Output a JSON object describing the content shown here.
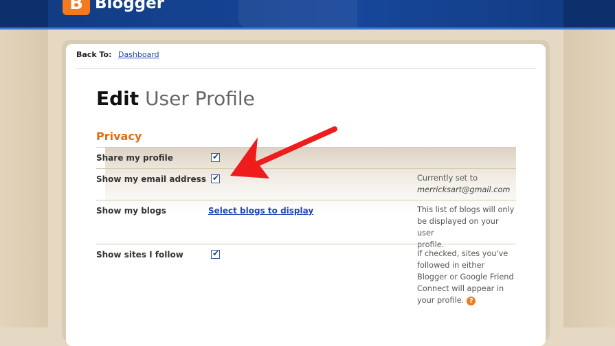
{
  "header": {
    "logo_letter": "B",
    "brand": "Blogger"
  },
  "nav": {
    "back_to_label": "Back To:",
    "back_to_link": "Dashboard"
  },
  "page": {
    "title_bold": "Edit",
    "title_light": "User Profile",
    "section": "Privacy"
  },
  "rows": [
    {
      "label": "Share my profile",
      "checked": true,
      "note_lines": []
    },
    {
      "label": "Show my email address",
      "checked": true,
      "note_lines": [
        "Currently set to"
      ],
      "note_italic": "merricksart@gmail.com"
    },
    {
      "label": "Show my blogs",
      "link": "Select blogs to display",
      "note_lines": [
        "This list of blogs will only",
        "be displayed on your user",
        "profile."
      ]
    },
    {
      "label": "Show sites I follow",
      "checked": true,
      "note_lines": [
        "If checked, sites you've",
        "followed in either",
        "Blogger or Google Friend",
        "Connect will appear in",
        "your profile."
      ]
    }
  ],
  "icons": {
    "help": "?",
    "check": "✔"
  },
  "colors": {
    "header_bg": "#0d2f6b",
    "accent_orange": "#e46b12",
    "link_blue": "#1f47b8",
    "arrow_red": "#ee1c1c"
  }
}
